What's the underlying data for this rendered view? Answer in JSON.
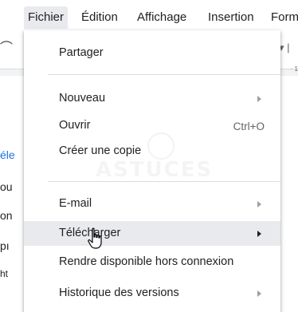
{
  "menubar": {
    "items": [
      {
        "label": "Fichier"
      },
      {
        "label": "Édition"
      },
      {
        "label": "Affichage"
      },
      {
        "label": "Insertion"
      },
      {
        "label": "Form"
      }
    ]
  },
  "background": {
    "left_fragments": [
      "éle",
      "ou",
      "on",
      "pı",
      "ht"
    ],
    "ruler_number": "· 1"
  },
  "file_menu": {
    "items": [
      {
        "label": "Partager",
        "shortcut": "",
        "submenu": false
      },
      {
        "label": "Nouveau",
        "shortcut": "",
        "submenu": true
      },
      {
        "label": "Ouvrir",
        "shortcut": "Ctrl+O",
        "submenu": false
      },
      {
        "label": "Créer une copie",
        "shortcut": "",
        "submenu": false
      },
      {
        "label": "E-mail",
        "shortcut": "",
        "submenu": true
      },
      {
        "label": "Télécharger",
        "shortcut": "",
        "submenu": true,
        "hovered": true
      },
      {
        "label": "Rendre disponible hors connexion",
        "shortcut": "",
        "submenu": false
      },
      {
        "label": "Historique des versions",
        "shortcut": "",
        "submenu": true
      }
    ]
  },
  "watermark": {
    "text": "ASTUCES"
  },
  "colors": {
    "menu_hover": "#e8eaed",
    "text": "#202124",
    "muted": "#5f6368",
    "link_blue": "#1a73e8"
  }
}
